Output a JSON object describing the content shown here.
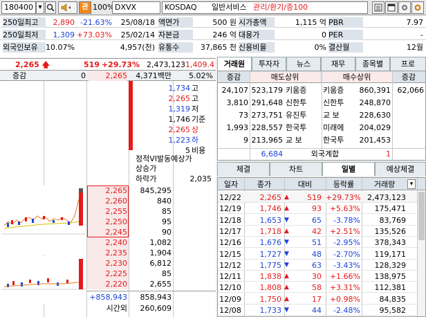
{
  "toolbar": {
    "code": "180400",
    "zoom": "100%",
    "name": "DXVX",
    "market": "KOSDAQ",
    "sector": "일반서비스",
    "status": "관리/환기/증100",
    "badge": "관"
  },
  "info": {
    "r1": [
      "250일최고",
      "2,890",
      "-21.63%",
      "25/08/18",
      "액면가",
      "500 원",
      "시가총액",
      "1,115 억",
      "PBR",
      "7.97"
    ],
    "r2": [
      "250일최저",
      "1,309",
      "+73.03%",
      "25/02/14",
      "자본금",
      "246 억",
      "대용가",
      "0",
      "PER",
      "-"
    ],
    "r3": [
      "외국인보유",
      "10.07%",
      "4,957(천)",
      "유통수",
      "37,865 천",
      "신용비율",
      "0%",
      "결산월",
      "12월"
    ]
  },
  "pricebar": {
    "price": "2,265",
    "change": "519",
    "rate": "+29.73%",
    "volume": "2,473,123",
    "prev_vol": "1,409.4"
  },
  "summary": {
    "label": "증감",
    "zero": "0",
    "price": "2,265",
    "amount": "4,371백만",
    "pct": "5.02%"
  },
  "ohlc": [
    {
      "v": "1,734",
      "l": "고"
    },
    {
      "v": "2,265",
      "l": "고"
    },
    {
      "v": "1,319",
      "l": "저"
    },
    {
      "v": "1,746",
      "l": "기준"
    },
    {
      "v": "2,265",
      "l": "상"
    },
    {
      "v": "1,223",
      "l": "하"
    },
    {
      "v": "5",
      "l": "비용"
    }
  ],
  "vi": {
    "title": "정적VI발동예상가",
    "up": "상승가",
    "down": "하락가",
    "down_val": "2,035"
  },
  "sell_book": [
    {
      "p": "2,265",
      "q": "845,295"
    },
    {
      "p": "2,260",
      "q": "840"
    },
    {
      "p": "2,255",
      "q": "85"
    },
    {
      "p": "2,250",
      "q": "95"
    },
    {
      "p": "2,245",
      "q": "90"
    }
  ],
  "buy_book": [
    {
      "p": "2,240",
      "q": "1,082"
    },
    {
      "p": "2,235",
      "q": "1,904"
    },
    {
      "p": "2,230",
      "q": "6,812"
    },
    {
      "p": "2,225",
      "q": "85"
    },
    {
      "p": "2,220",
      "q": "2,655"
    }
  ],
  "book_total": {
    "diff": "+858,943",
    "total": "858,943",
    "after": "시간외",
    "after_val": "260,609"
  },
  "tabs_top": [
    "거래원",
    "투자자",
    "뉴스",
    "재무",
    "종목별",
    "프로"
  ],
  "broker": {
    "headers": [
      "증감",
      "매도상위",
      "매수상위",
      "증감"
    ],
    "rows": [
      {
        "d": "24,107",
        "sv": "523,179",
        "sn": "키움증",
        "bn": "키움증",
        "bv": "860,391",
        "bd": "62,066"
      },
      {
        "d": "3,810",
        "sv": "291,648",
        "sn": "신한투",
        "bn": "신한투",
        "bv": "248,870",
        "bd": ""
      },
      {
        "d": "73",
        "sv": "273,751",
        "sn": "유진투",
        "bn": "교 보",
        "bv": "228,630",
        "bd": ""
      },
      {
        "d": "1,993",
        "sv": "228,557",
        "sn": "한국투",
        "bn": "미래에",
        "bv": "204,029",
        "bd": ""
      },
      {
        "d": "9",
        "sv": "213,965",
        "sn": "교 보",
        "bn": "한국투",
        "bv": "201,453",
        "bd": ""
      }
    ],
    "foreign": {
      "v": "6,684",
      "label": "외국계합",
      "buy": "1"
    }
  },
  "tabs_mid": [
    "체결",
    "차트",
    "일별",
    "예상체결"
  ],
  "daily": {
    "headers": [
      "일자",
      "종가",
      "대비",
      "등락률",
      "거래량"
    ],
    "rows": [
      {
        "date": "12/22",
        "close": "2,265",
        "arrow": "up",
        "chg": "519",
        "rate": "+29.73%",
        "vol": "2,473,123"
      },
      {
        "date": "12/19",
        "close": "1,746",
        "arrow": "up",
        "chg": "93",
        "rate": "+5.63%",
        "vol": "175,471"
      },
      {
        "date": "12/18",
        "close": "1,653",
        "arrow": "dn",
        "chg": "65",
        "rate": "-3.78%",
        "vol": "83,769"
      },
      {
        "date": "12/17",
        "close": "1,718",
        "arrow": "up",
        "chg": "42",
        "rate": "+2.51%",
        "vol": "135,526"
      },
      {
        "date": "12/16",
        "close": "1,676",
        "arrow": "dn",
        "chg": "51",
        "rate": "-2.95%",
        "vol": "378,343"
      },
      {
        "date": "12/15",
        "close": "1,727",
        "arrow": "dn",
        "chg": "48",
        "rate": "-2.70%",
        "vol": "119,171"
      },
      {
        "date": "12/12",
        "close": "1,775",
        "arrow": "dn",
        "chg": "63",
        "rate": "-3.43%",
        "vol": "128,329"
      },
      {
        "date": "12/11",
        "close": "1,838",
        "arrow": "up",
        "chg": "30",
        "rate": "+1.66%",
        "vol": "138,975"
      },
      {
        "date": "12/10",
        "close": "1,808",
        "arrow": "up",
        "chg": "58",
        "rate": "+3.31%",
        "vol": "112,381"
      },
      {
        "date": "12/09",
        "close": "1,750",
        "arrow": "up",
        "chg": "17",
        "rate": "+0.98%",
        "vol": "84,835"
      },
      {
        "date": "12/08",
        "close": "1,733",
        "arrow": "dn",
        "chg": "44",
        "rate": "-2.48%",
        "vol": "95,582"
      }
    ]
  }
}
